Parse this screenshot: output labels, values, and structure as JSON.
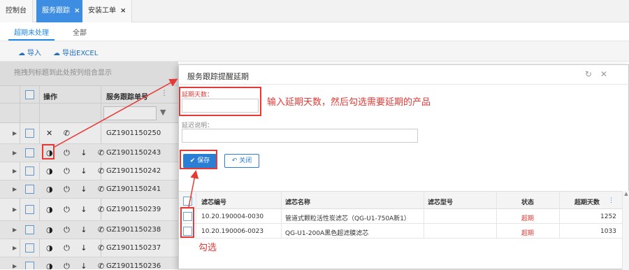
{
  "top_tabs": [
    {
      "label": "控制台"
    },
    {
      "label": "服务跟踪",
      "close": "×"
    },
    {
      "label": "安装工单",
      "close": "×"
    }
  ],
  "sub_tabs": [
    "超期未处理",
    "全部"
  ],
  "toolbar": {
    "import_label": "导入",
    "export_label": "导出EXCEL"
  },
  "group_hint": "拖拽列标题到此处按列组合显示",
  "grid": {
    "headers": {
      "ops": "操作",
      "no": "服务跟踪单号"
    },
    "rows": [
      {
        "ops": "✕ ✆",
        "no": "GZ1901150250"
      },
      {
        "ops": "◑ ⏻ ↓ ✆",
        "no": "GZ1901150243"
      },
      {
        "ops": "◑ ⏻ ↓ ✆",
        "no": "GZ1901150242"
      },
      {
        "ops": "◑ ⏻ ↓ ✆",
        "no": "GZ1901150241"
      },
      {
        "ops": "◑ ⏻ ↓ ✆",
        "no": "GZ1901150239"
      },
      {
        "ops": "◑ ⏻ ↓ ✆",
        "no": "GZ1901150238"
      },
      {
        "ops": "◑ ⏻ ↓ ✆",
        "no": "GZ1901150237"
      },
      {
        "ops": "◑ ⏻ ↓ ✆",
        "no": "GZ1901150236"
      }
    ]
  },
  "modal": {
    "title": "服务跟踪提醒延期",
    "days_label": "延期天数：",
    "days_value": "",
    "note_label": "延迟说明：",
    "note_value": "",
    "save_label": "保存",
    "close_label": "关闭",
    "table": {
      "headers": [
        "滤芯编号",
        "滤芯名称",
        "滤芯型号",
        "状态",
        "超期天数"
      ],
      "rows": [
        {
          "code": "10.20.190004-0030",
          "name": "管道式颗粒活性炭滤芯（QG-U1-750A新1）",
          "model": "",
          "status": "超期",
          "days": "1252"
        },
        {
          "code": "10.20.190006-0023",
          "name": "QG-U1-200A黑色超滤膜滤芯",
          "model": "",
          "status": "超期",
          "days": "1033"
        }
      ]
    }
  },
  "annotations": {
    "instruction": "输入延期天数，然后勾选需要延期的产品",
    "check": "勾选"
  },
  "colors": {
    "accent": "#2a7fd4",
    "annotation": "#e53935"
  }
}
